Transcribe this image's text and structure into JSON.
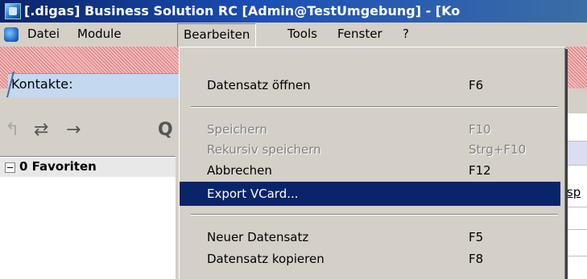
{
  "window": {
    "title": "[.digas] Business Solution RC [Admin@TestUmgebung] - [Ko",
    "icon": "app-icon"
  },
  "menubar": {
    "items": [
      {
        "label": "Datei"
      },
      {
        "label": "Module"
      },
      {
        "label": "Bearbeiten",
        "open": true
      },
      {
        "label": "Tools"
      },
      {
        "label": "Fenster"
      },
      {
        "label": "?"
      }
    ]
  },
  "tab": {
    "label": "Kontakte:"
  },
  "toolbar": {
    "icons": [
      "undo-arrow-icon",
      "redo-arrow-icon",
      "forward-arrow-icon",
      "search-icon"
    ]
  },
  "tree": {
    "root_label": "0 Favoriten"
  },
  "background_text": {
    "clipped_column": "tsp"
  },
  "dropdown": {
    "items": [
      {
        "label": "Datensatz öffnen",
        "shortcut": "F6",
        "enabled": true
      },
      {
        "label": "Speichern",
        "shortcut": "F10",
        "enabled": false
      },
      {
        "label": "Rekursiv speichern",
        "shortcut": "Strg+F10",
        "enabled": false
      },
      {
        "label": "Abbrechen",
        "shortcut": "F12",
        "enabled": true
      },
      {
        "label": "Export VCard...",
        "shortcut": "",
        "enabled": true,
        "highlighted": true
      },
      {
        "label": "Neuer Datensatz",
        "shortcut": "F5",
        "enabled": true
      },
      {
        "label": "Datensatz kopieren",
        "shortcut": "F8",
        "enabled": true
      }
    ]
  },
  "colors": {
    "titlebar": "#0a246a",
    "highlight": "#0a246a",
    "hatch": "#e8a0a0",
    "tab": "#c4d8ef"
  }
}
